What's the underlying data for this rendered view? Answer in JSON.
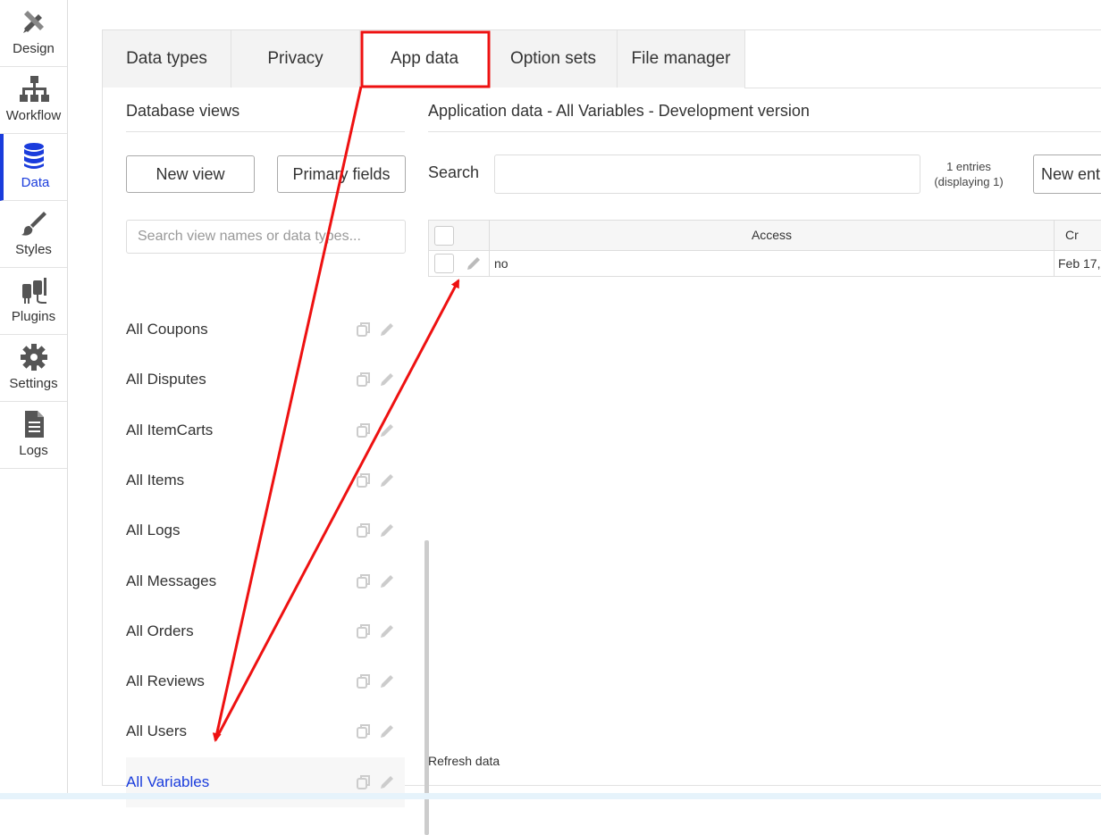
{
  "sidebar": {
    "items": [
      {
        "label": "Design",
        "icon": "design-icon"
      },
      {
        "label": "Workflow",
        "icon": "workflow-icon"
      },
      {
        "label": "Data",
        "icon": "database-icon"
      },
      {
        "label": "Styles",
        "icon": "brush-icon"
      },
      {
        "label": "Plugins",
        "icon": "plugin-icon"
      },
      {
        "label": "Settings",
        "icon": "gear-icon"
      },
      {
        "label": "Logs",
        "icon": "document-icon"
      }
    ],
    "active": "Data"
  },
  "tabs": [
    {
      "label": "Data types"
    },
    {
      "label": "Privacy"
    },
    {
      "label": "App data"
    },
    {
      "label": "Option sets"
    },
    {
      "label": "File manager"
    }
  ],
  "active_tab": "App data",
  "database_views": {
    "title": "Database views",
    "new_view_label": "New view",
    "primary_fields_label": "Primary fields",
    "search_placeholder": "Search view names or data types...",
    "views": [
      {
        "label": "All Coupons"
      },
      {
        "label": "All Disputes"
      },
      {
        "label": "All ItemCarts"
      },
      {
        "label": "All Items"
      },
      {
        "label": "All Logs"
      },
      {
        "label": "All Messages"
      },
      {
        "label": "All Orders"
      },
      {
        "label": "All Reviews"
      },
      {
        "label": "All Users"
      },
      {
        "label": "All Variables"
      }
    ],
    "selected": "All Variables"
  },
  "app_data": {
    "title": "Application data - All Variables - Development version",
    "search_label": "Search",
    "search_value": "",
    "entries_line1": "1 entries",
    "entries_line2": "(displaying 1)",
    "new_entry_label": "New ent",
    "columns": [
      "Access",
      "Cr"
    ],
    "rows": [
      {
        "access": "no",
        "created": "Feb 17,"
      }
    ],
    "refresh_label": "Refresh data"
  },
  "colors": {
    "accent": "#1a3cdc",
    "annotation": "#ee1111"
  }
}
